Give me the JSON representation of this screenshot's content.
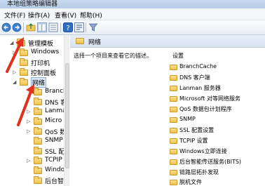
{
  "window": {
    "title": "本地组策略编辑器"
  },
  "menu": [
    {
      "label": "文件(F)"
    },
    {
      "label": "操作(A)"
    },
    {
      "label": "查看(V)"
    },
    {
      "label": "帮助(H)"
    }
  ],
  "toolbar": {
    "icons": [
      "back-icon",
      "forward-icon",
      "up-folder-icon",
      "show-hide-tree-icon",
      "export-list-icon",
      "help-icon",
      "properties-icon",
      "filter-icon"
    ]
  },
  "tree": {
    "items": [
      {
        "label": "管理模板",
        "expanded": true
      },
      {
        "label": "Windows",
        "expanded": false
      },
      {
        "label": "打印机",
        "expanded": false
      },
      {
        "label": "控制面板",
        "expanded": false
      },
      {
        "label": "网络",
        "expanded": true,
        "selected": true
      },
      {
        "label": "Branch",
        "expanded": false
      },
      {
        "label": "DNS 客",
        "expanded": false
      },
      {
        "label": "Lanma",
        "expanded": false
      },
      {
        "label": "Micro",
        "expanded": false
      },
      {
        "label": "QoS 数",
        "expanded": false
      },
      {
        "label": "SNMP",
        "expanded": false
      },
      {
        "label": "SSL 配",
        "expanded": false
      },
      {
        "label": "TCPIP",
        "expanded": false
      },
      {
        "label": "Windo",
        "expanded": false
      },
      {
        "label": "后台智",
        "expanded": false
      }
    ]
  },
  "main": {
    "header_title": "网络",
    "description": "选择一个项目来查看它的描述。",
    "column_header": "设置",
    "items": [
      "BranchCache",
      "DNS 客户端",
      "Lanman 服务器",
      "Microsoft 对等网络服务",
      "QoS 数据包计划程序",
      "SNMP",
      "SSL 配置设置",
      "TCPIP 设置",
      "Windows立即连接",
      "后台智能传送服务(BITS)",
      "链路层拓扑发现",
      "脱机文件"
    ]
  },
  "colors": {
    "annotation_arrow": "#e0301e",
    "folder": "#ecc24c",
    "selection": "#dbe8f8"
  }
}
